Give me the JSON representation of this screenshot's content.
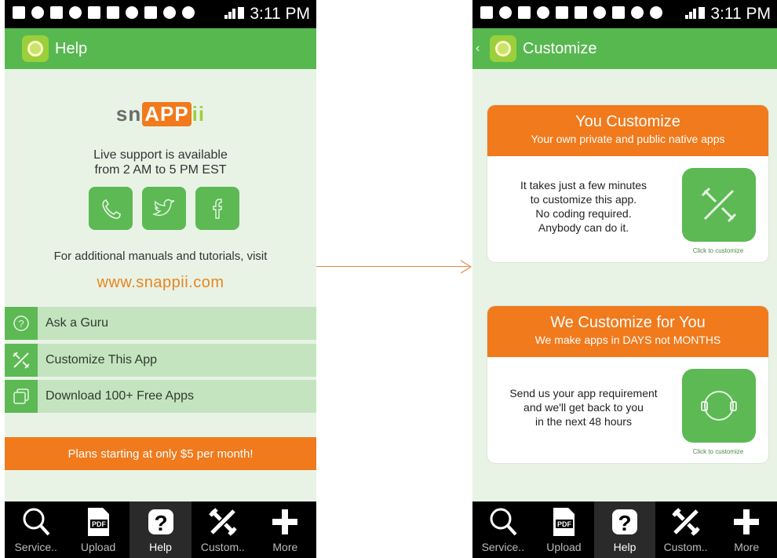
{
  "status_time": "3:11 PM",
  "left": {
    "appbar_title": "Help",
    "logo": {
      "sn": "sn",
      "app": "APP",
      "ii": "ii"
    },
    "support_line1": "Live support is available",
    "support_line2": "from 2 AM to 5 PM EST",
    "manuals_text": "For additional manuals and tutorials, visit",
    "website": "www.snappii.com",
    "menu": [
      {
        "label": "Ask a Guru",
        "icon": "question-circle-icon"
      },
      {
        "label": "Customize This App",
        "icon": "tools-icon"
      },
      {
        "label": "Download 100+ Free Apps",
        "icon": "stacked-squares-icon"
      }
    ],
    "banner": "Plans starting at only $5 per month!"
  },
  "right": {
    "appbar_title": "Customize",
    "back": "‹",
    "card1": {
      "title": "You Customize",
      "subtitle": "Your own private and public native apps",
      "line1": "It takes just a few minutes",
      "line2": "to customize this app.",
      "line3": "No coding required.",
      "line4": "Anybody can do it.",
      "caption": "Click to customize"
    },
    "card2": {
      "title": "We Customize for You",
      "subtitle": "We make apps in DAYS not MONTHS",
      "line1": "Send us your app requirement",
      "line2": "and we'll get back to you",
      "line3": "in the next 48 hours",
      "caption": "Click to customize"
    }
  },
  "nav": {
    "items": [
      {
        "label": "Service..",
        "icon": "search-icon"
      },
      {
        "label": "Upload",
        "icon": "pdf-icon"
      },
      {
        "label": "Help",
        "icon": "help-icon"
      },
      {
        "label": "Custom..",
        "icon": "tools-icon"
      },
      {
        "label": "More",
        "icon": "plus-icon"
      }
    ],
    "pdf_text": "PDF",
    "help_glyph": "?"
  },
  "colors": {
    "green": "#57b84f",
    "orange": "#f07a1c",
    "link": "#e8851f",
    "background": "#e8f3e6"
  }
}
